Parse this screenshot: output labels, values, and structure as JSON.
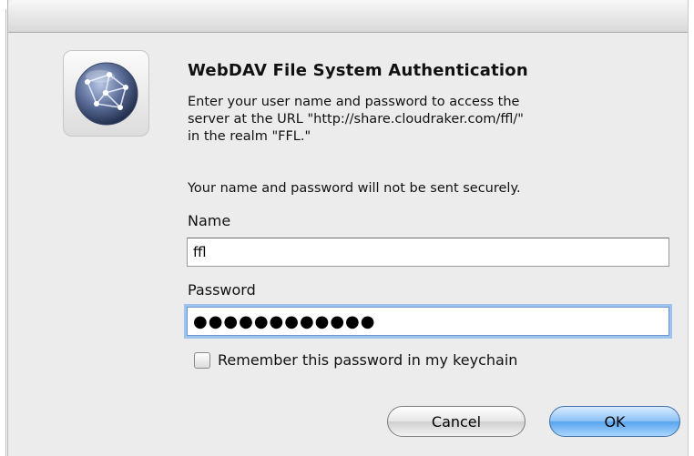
{
  "dialog": {
    "title": "WebDAV File System Authentication",
    "message_lines": [
      "Enter your user name and password to access the",
      "server at the URL \"http://share.cloudraker.com/ffl/\"",
      "in the realm \"FFL.\""
    ],
    "warning": "Your name and password will not be sent securely.",
    "icon": "network-globe-icon"
  },
  "form": {
    "name_label": "Name",
    "name_value": "ffl",
    "password_label": "Password",
    "password_value": "●●●●●●●●●●●●",
    "remember_label": "Remember this password in my keychain",
    "remember_checked": false
  },
  "buttons": {
    "cancel_label": "Cancel",
    "ok_label": "OK"
  },
  "colors": {
    "dialog_bg": "#ececec",
    "ok_button": "#5aa4ee",
    "focus_ring": "#9ec4ee"
  }
}
